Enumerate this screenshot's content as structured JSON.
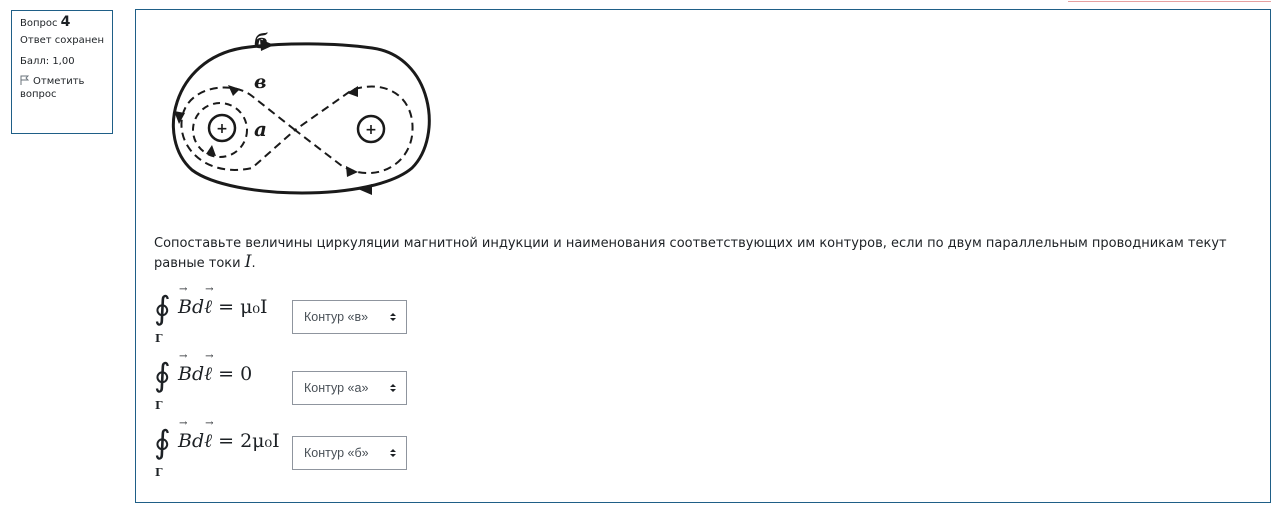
{
  "question_info": {
    "question_label": "Вопрос",
    "question_number": "4",
    "state": "Ответ сохранен",
    "grade": "Балл: 1,00",
    "flag_label": "Отметить вопрос"
  },
  "figure": {
    "labels": {
      "a": "а",
      "b": "б",
      "v": "в"
    },
    "conductor_symbol": "+"
  },
  "question": {
    "text": "Сопоставьте величины циркуляции магнитной индукции и наименования соответствующих им контуров, если по двум параллельным проводникам текут равные токи ",
    "current_symbol": "I",
    "period": "."
  },
  "matches": [
    {
      "contour_symbol": "Г",
      "rhs": "μ₀I",
      "selected": "Контур «в»"
    },
    {
      "contour_symbol": "Г",
      "rhs": "0",
      "selected": "Контур «а»"
    },
    {
      "contour_symbol": "Г",
      "rhs": "2μ₀I",
      "selected": "Контур «б»"
    }
  ]
}
